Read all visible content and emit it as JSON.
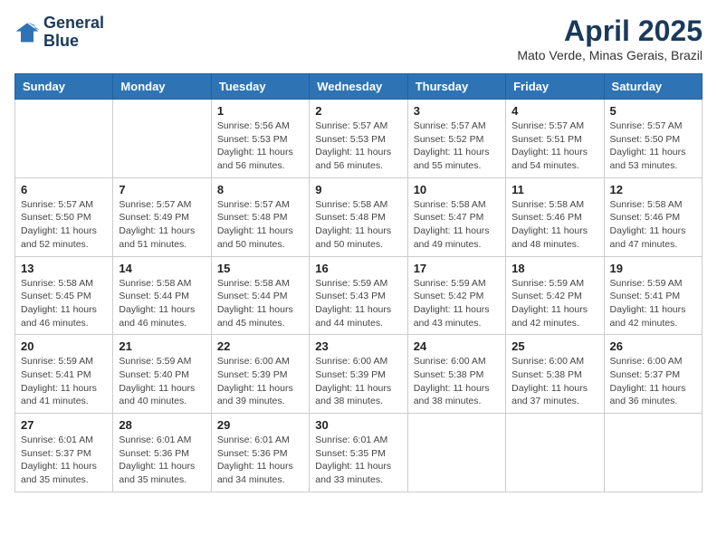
{
  "header": {
    "logo_line1": "General",
    "logo_line2": "Blue",
    "month": "April 2025",
    "location": "Mato Verde, Minas Gerais, Brazil"
  },
  "days_of_week": [
    "Sunday",
    "Monday",
    "Tuesday",
    "Wednesday",
    "Thursday",
    "Friday",
    "Saturday"
  ],
  "weeks": [
    [
      {
        "day": "",
        "info": ""
      },
      {
        "day": "",
        "info": ""
      },
      {
        "day": "1",
        "info": "Sunrise: 5:56 AM\nSunset: 5:53 PM\nDaylight: 11 hours and 56 minutes."
      },
      {
        "day": "2",
        "info": "Sunrise: 5:57 AM\nSunset: 5:53 PM\nDaylight: 11 hours and 56 minutes."
      },
      {
        "day": "3",
        "info": "Sunrise: 5:57 AM\nSunset: 5:52 PM\nDaylight: 11 hours and 55 minutes."
      },
      {
        "day": "4",
        "info": "Sunrise: 5:57 AM\nSunset: 5:51 PM\nDaylight: 11 hours and 54 minutes."
      },
      {
        "day": "5",
        "info": "Sunrise: 5:57 AM\nSunset: 5:50 PM\nDaylight: 11 hours and 53 minutes."
      }
    ],
    [
      {
        "day": "6",
        "info": "Sunrise: 5:57 AM\nSunset: 5:50 PM\nDaylight: 11 hours and 52 minutes."
      },
      {
        "day": "7",
        "info": "Sunrise: 5:57 AM\nSunset: 5:49 PM\nDaylight: 11 hours and 51 minutes."
      },
      {
        "day": "8",
        "info": "Sunrise: 5:57 AM\nSunset: 5:48 PM\nDaylight: 11 hours and 50 minutes."
      },
      {
        "day": "9",
        "info": "Sunrise: 5:58 AM\nSunset: 5:48 PM\nDaylight: 11 hours and 50 minutes."
      },
      {
        "day": "10",
        "info": "Sunrise: 5:58 AM\nSunset: 5:47 PM\nDaylight: 11 hours and 49 minutes."
      },
      {
        "day": "11",
        "info": "Sunrise: 5:58 AM\nSunset: 5:46 PM\nDaylight: 11 hours and 48 minutes."
      },
      {
        "day": "12",
        "info": "Sunrise: 5:58 AM\nSunset: 5:46 PM\nDaylight: 11 hours and 47 minutes."
      }
    ],
    [
      {
        "day": "13",
        "info": "Sunrise: 5:58 AM\nSunset: 5:45 PM\nDaylight: 11 hours and 46 minutes."
      },
      {
        "day": "14",
        "info": "Sunrise: 5:58 AM\nSunset: 5:44 PM\nDaylight: 11 hours and 46 minutes."
      },
      {
        "day": "15",
        "info": "Sunrise: 5:58 AM\nSunset: 5:44 PM\nDaylight: 11 hours and 45 minutes."
      },
      {
        "day": "16",
        "info": "Sunrise: 5:59 AM\nSunset: 5:43 PM\nDaylight: 11 hours and 44 minutes."
      },
      {
        "day": "17",
        "info": "Sunrise: 5:59 AM\nSunset: 5:42 PM\nDaylight: 11 hours and 43 minutes."
      },
      {
        "day": "18",
        "info": "Sunrise: 5:59 AM\nSunset: 5:42 PM\nDaylight: 11 hours and 42 minutes."
      },
      {
        "day": "19",
        "info": "Sunrise: 5:59 AM\nSunset: 5:41 PM\nDaylight: 11 hours and 42 minutes."
      }
    ],
    [
      {
        "day": "20",
        "info": "Sunrise: 5:59 AM\nSunset: 5:41 PM\nDaylight: 11 hours and 41 minutes."
      },
      {
        "day": "21",
        "info": "Sunrise: 5:59 AM\nSunset: 5:40 PM\nDaylight: 11 hours and 40 minutes."
      },
      {
        "day": "22",
        "info": "Sunrise: 6:00 AM\nSunset: 5:39 PM\nDaylight: 11 hours and 39 minutes."
      },
      {
        "day": "23",
        "info": "Sunrise: 6:00 AM\nSunset: 5:39 PM\nDaylight: 11 hours and 38 minutes."
      },
      {
        "day": "24",
        "info": "Sunrise: 6:00 AM\nSunset: 5:38 PM\nDaylight: 11 hours and 38 minutes."
      },
      {
        "day": "25",
        "info": "Sunrise: 6:00 AM\nSunset: 5:38 PM\nDaylight: 11 hours and 37 minutes."
      },
      {
        "day": "26",
        "info": "Sunrise: 6:00 AM\nSunset: 5:37 PM\nDaylight: 11 hours and 36 minutes."
      }
    ],
    [
      {
        "day": "27",
        "info": "Sunrise: 6:01 AM\nSunset: 5:37 PM\nDaylight: 11 hours and 35 minutes."
      },
      {
        "day": "28",
        "info": "Sunrise: 6:01 AM\nSunset: 5:36 PM\nDaylight: 11 hours and 35 minutes."
      },
      {
        "day": "29",
        "info": "Sunrise: 6:01 AM\nSunset: 5:36 PM\nDaylight: 11 hours and 34 minutes."
      },
      {
        "day": "30",
        "info": "Sunrise: 6:01 AM\nSunset: 5:35 PM\nDaylight: 11 hours and 33 minutes."
      },
      {
        "day": "",
        "info": ""
      },
      {
        "day": "",
        "info": ""
      },
      {
        "day": "",
        "info": ""
      }
    ]
  ]
}
